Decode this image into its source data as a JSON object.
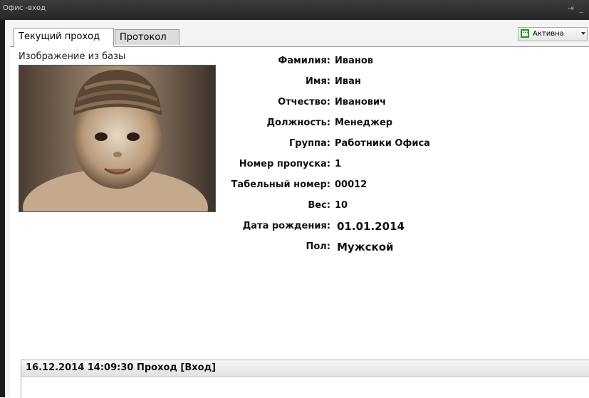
{
  "window": {
    "title": "Офис -вход",
    "controls": "⇥ _"
  },
  "tabs": [
    {
      "label": "Текущий проход",
      "active": true
    },
    {
      "label": "Протокол",
      "active": false
    }
  ],
  "status": {
    "label": "Активна",
    "icon": "dots-icon",
    "color": "#1a9a1a"
  },
  "photo": {
    "caption": "Изображение из базы"
  },
  "fields": [
    {
      "label": "Фамилия:",
      "value": "Иванов"
    },
    {
      "label": "Имя:",
      "value": "Иван"
    },
    {
      "label": "Отчество:",
      "value": "Иванович"
    },
    {
      "label": "Должность:",
      "value": "Менеджер"
    },
    {
      "label": "Группа:",
      "value": "Работники Офиса"
    },
    {
      "label": "Номер пропуска:",
      "value": "1"
    },
    {
      "label": "Табельный номер:",
      "value": "00012"
    },
    {
      "label": "Вес:",
      "value": "10"
    },
    {
      "label": "Дата рождения:",
      "value": "01.01.2014"
    },
    {
      "label": "Пол:",
      "value": "Мужской"
    }
  ],
  "log": {
    "entry": "16.12.2014 14:09:30 Проход [Вход]"
  }
}
